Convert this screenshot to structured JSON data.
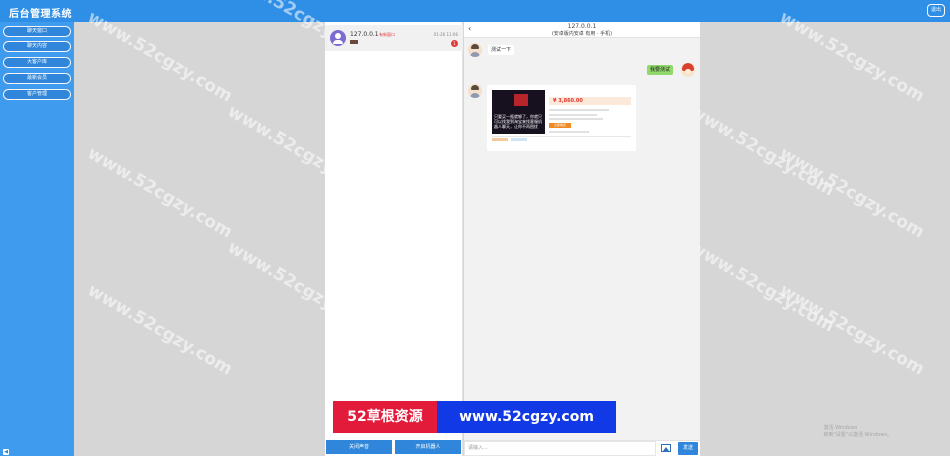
{
  "app": {
    "title": "后台管理系统",
    "logout_label": "退出"
  },
  "sidebar": {
    "items": [
      {
        "label": "聊天窗口"
      },
      {
        "label": "聊天内容"
      },
      {
        "label": "大客户库"
      },
      {
        "label": "最新会员"
      },
      {
        "label": "客户管理"
      }
    ]
  },
  "conversation": {
    "ip": "127.0.0.1",
    "source": "有新窗口",
    "time": "01-26 11:06",
    "unread": "1"
  },
  "list_buttons": {
    "close_voice": "关闭声音",
    "open_robot": "开启机器人"
  },
  "chat": {
    "header_ip": "127.0.0.1",
    "header_device": "(安卓版内安卓 有用 · 手机)",
    "msg_received": "测试一下",
    "msg_sent": "我要测试",
    "product": {
      "caption": "只要买一瓶就够了，你就只可以找我到淘宝来找客服机器人聊天，让你不再困扰",
      "price": "¥ 3,860.00",
      "buy_label": "立即购买"
    },
    "input_placeholder": "请输入...",
    "send_label": "发送"
  },
  "banner": {
    "part1": "52草根资源",
    "part2": "www.52cgzy.com"
  },
  "watermark": {
    "text": "www.52cgzy.com"
  },
  "activation": {
    "line1": "激活 Windows",
    "line2": "转到\"设置\"以激活 Windows。"
  },
  "colors": {
    "topbar": "#2f8fe6",
    "sidebar": "#3f9bee",
    "button": "#2f86da",
    "banner_red": "#e21b3a",
    "banner_blue": "#1239e6"
  }
}
